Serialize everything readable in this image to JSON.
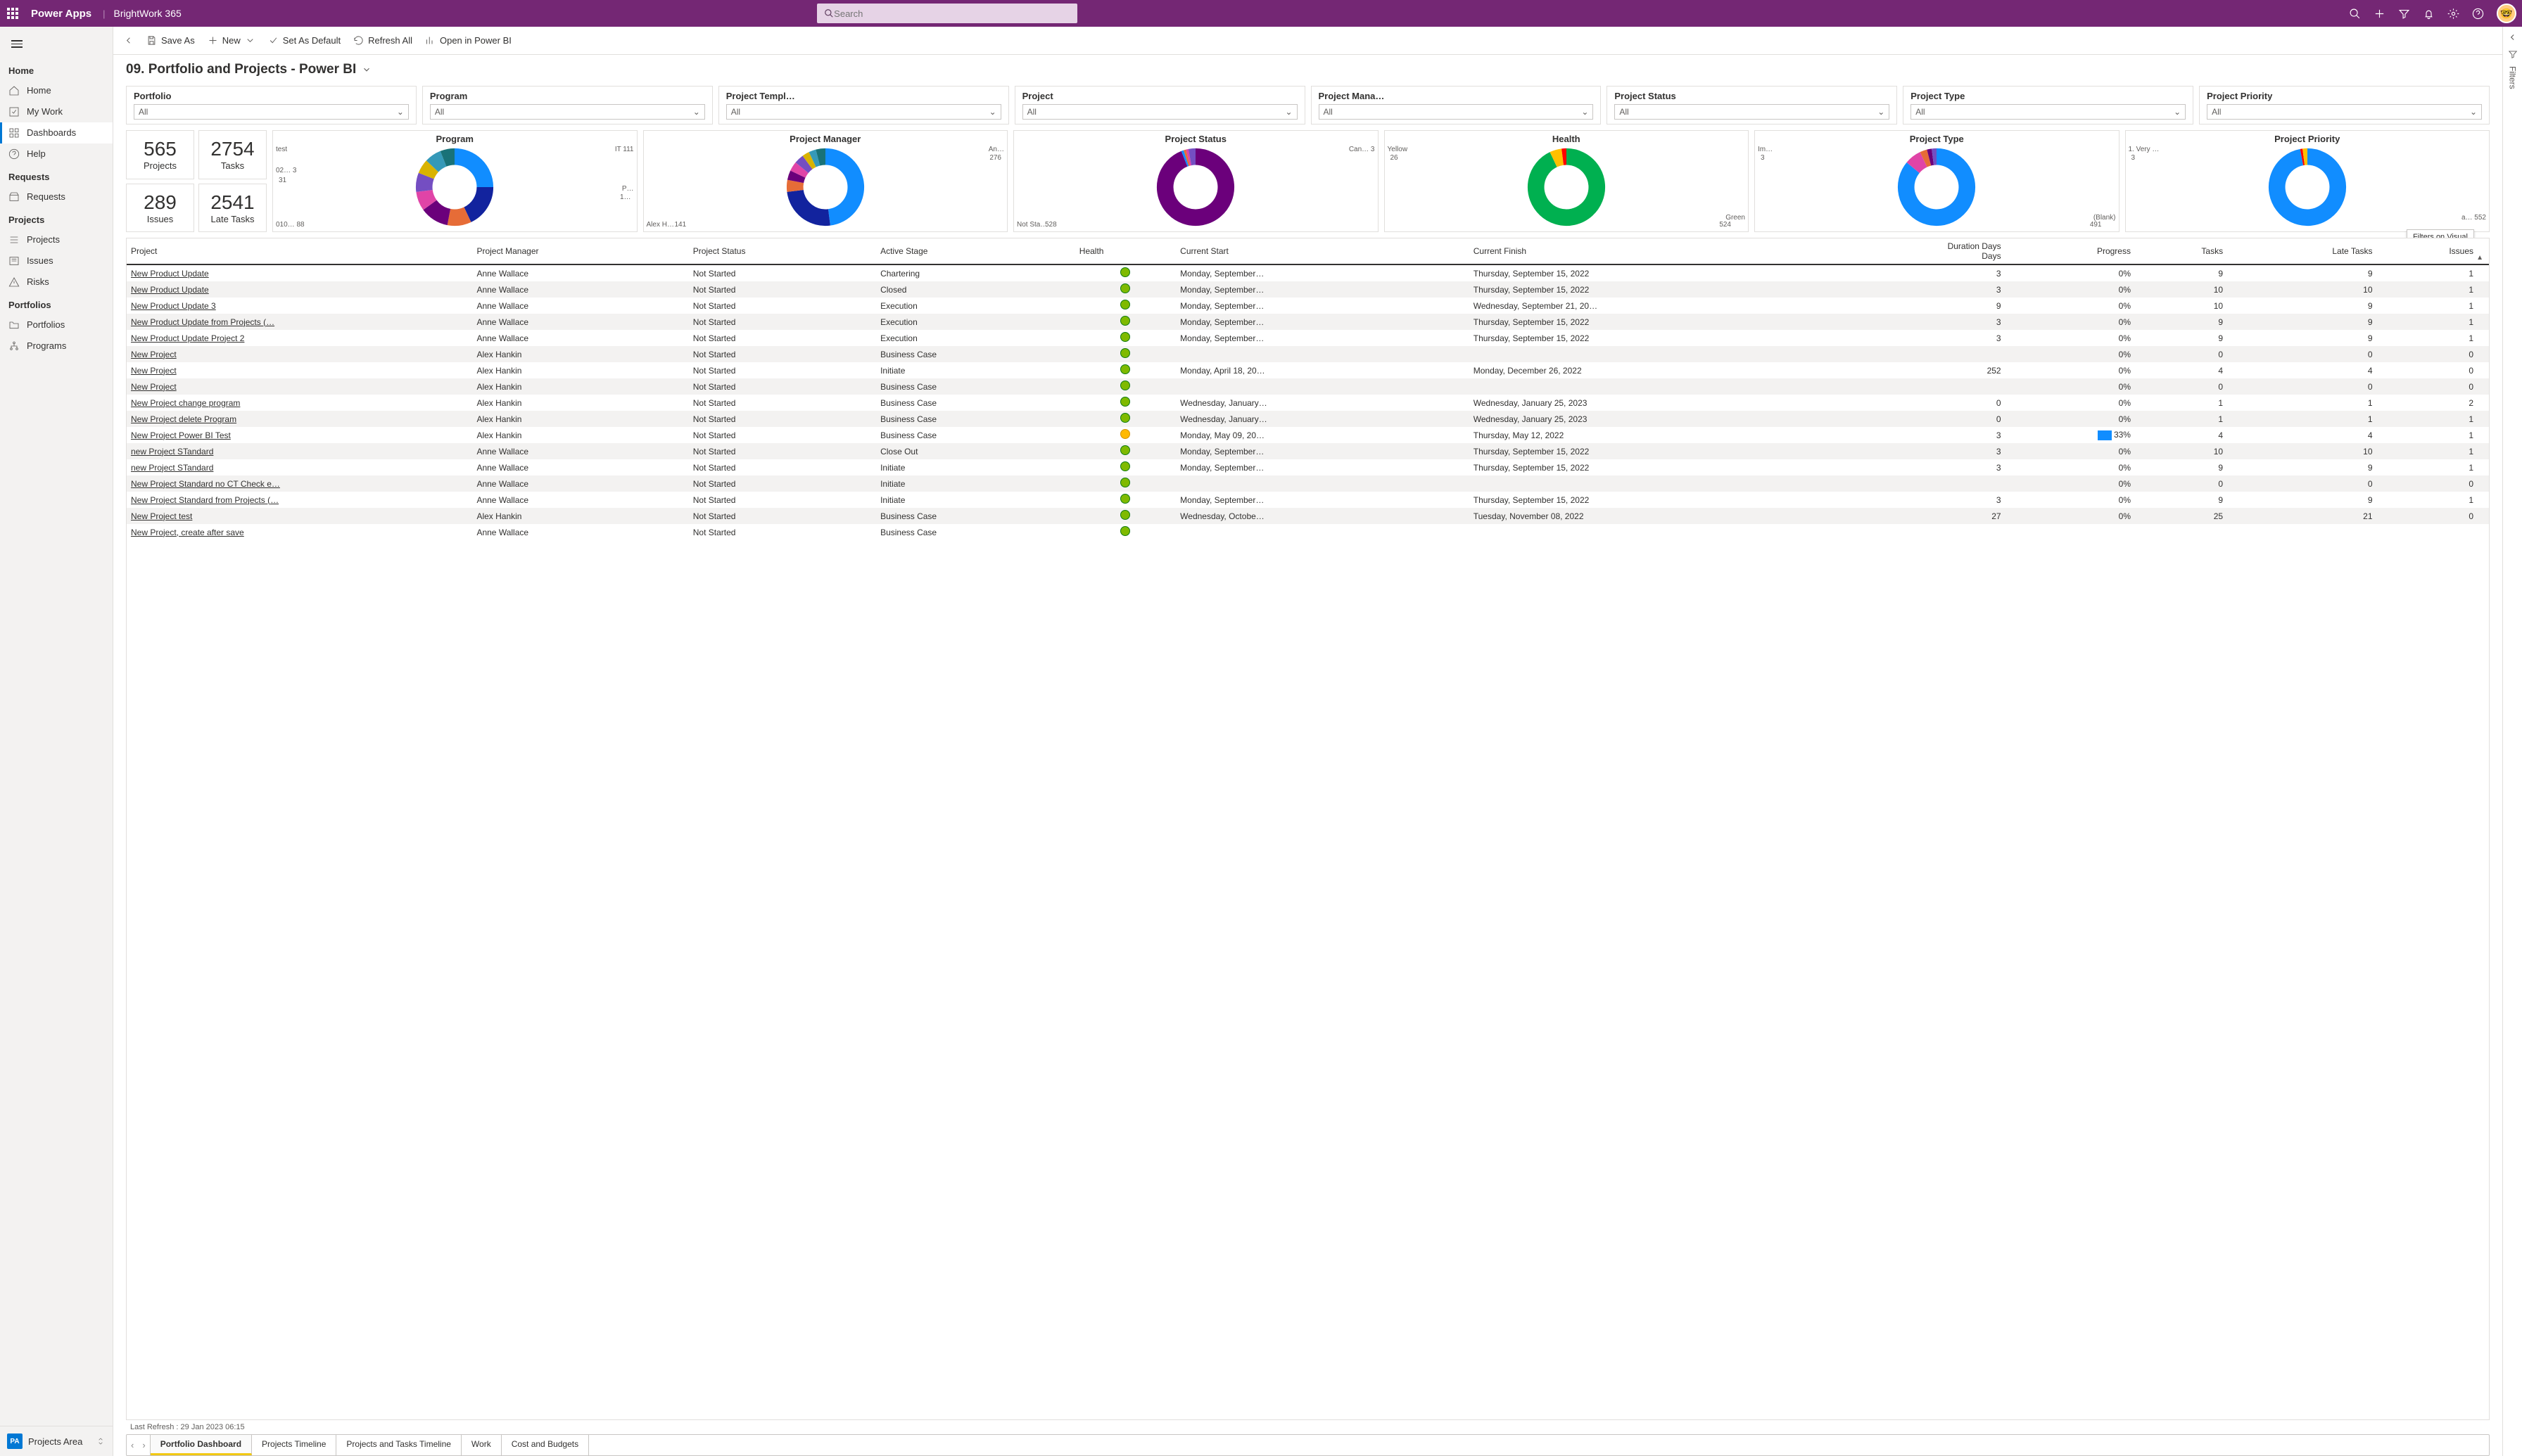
{
  "topbar": {
    "app": "Power Apps",
    "workspace": "BrightWork 365",
    "search_placeholder": "Search"
  },
  "sidebar": {
    "groups": [
      {
        "label": "Home",
        "items": [
          {
            "label": "Home",
            "icon": "home"
          },
          {
            "label": "My Work",
            "icon": "check"
          },
          {
            "label": "Dashboards",
            "icon": "dash",
            "selected": true
          },
          {
            "label": "Help",
            "icon": "help"
          }
        ]
      },
      {
        "label": "Requests",
        "items": [
          {
            "label": "Requests",
            "icon": "inbox"
          }
        ]
      },
      {
        "label": "Projects",
        "items": [
          {
            "label": "Projects",
            "icon": "list"
          },
          {
            "label": "Issues",
            "icon": "issue"
          },
          {
            "label": "Risks",
            "icon": "warn"
          }
        ]
      },
      {
        "label": "Portfolios",
        "items": [
          {
            "label": "Portfolios",
            "icon": "folder"
          },
          {
            "label": "Programs",
            "icon": "sitemap"
          }
        ]
      }
    ],
    "area": {
      "badge": "PA",
      "label": "Projects Area"
    }
  },
  "cmdbar": {
    "save_as": "Save As",
    "new": "New",
    "set_default": "Set As Default",
    "refresh": "Refresh All",
    "open_pbi": "Open in Power BI"
  },
  "title": "09. Portfolio and Projects - Power BI",
  "slicers": [
    {
      "label": "Portfolio",
      "value": "All"
    },
    {
      "label": "Program",
      "value": "All"
    },
    {
      "label": "Project Templ…",
      "value": "All"
    },
    {
      "label": "Project",
      "value": "All"
    },
    {
      "label": "Project Mana…",
      "value": "All"
    },
    {
      "label": "Project Status",
      "value": "All"
    },
    {
      "label": "Project Type",
      "value": "All"
    },
    {
      "label": "Project Priority",
      "value": "All"
    }
  ],
  "kpis": [
    {
      "value": "565",
      "label": "Projects"
    },
    {
      "value": "2754",
      "label": "Tasks"
    },
    {
      "value": "289",
      "label": "Issues"
    },
    {
      "value": "2541",
      "label": "Late Tasks"
    }
  ],
  "chart_data": [
    {
      "type": "pie",
      "title": "Program",
      "labels": [
        {
          "text": "test",
          "pos": "tl"
        },
        {
          "text": "IT 111",
          "pos": "tr"
        },
        {
          "text": "02…  3",
          "pos": "l1"
        },
        {
          "text": "31",
          "pos": "l2"
        },
        {
          "text": "P…",
          "pos": "r1"
        },
        {
          "text": "1…",
          "pos": "r2"
        },
        {
          "text": "010… 88",
          "pos": "bl"
        }
      ],
      "segments": [
        {
          "color": "#118dff",
          "v": 25
        },
        {
          "color": "#12239e",
          "v": 18
        },
        {
          "color": "#e66c37",
          "v": 10
        },
        {
          "color": "#6b007b",
          "v": 12
        },
        {
          "color": "#e044a7",
          "v": 8
        },
        {
          "color": "#744ec2",
          "v": 8
        },
        {
          "color": "#d9b300",
          "v": 6
        },
        {
          "color": "#3599b8",
          "v": 7
        },
        {
          "color": "#197278",
          "v": 6
        }
      ]
    },
    {
      "type": "pie",
      "title": "Project Manager",
      "labels": [
        {
          "text": "An…",
          "pos": "tr"
        },
        {
          "text": "276",
          "pos": "tr2"
        },
        {
          "text": "Alex H…",
          "pos": "bl"
        },
        {
          "text": "141",
          "pos": "bl2"
        }
      ],
      "segments": [
        {
          "color": "#118dff",
          "v": 48
        },
        {
          "color": "#12239e",
          "v": 25
        },
        {
          "color": "#e66c37",
          "v": 5
        },
        {
          "color": "#6b007b",
          "v": 4
        },
        {
          "color": "#e044a7",
          "v": 4
        },
        {
          "color": "#744ec2",
          "v": 4
        },
        {
          "color": "#d9b300",
          "v": 3
        },
        {
          "color": "#3599b8",
          "v": 3
        },
        {
          "color": "#197278",
          "v": 4
        }
      ]
    },
    {
      "type": "pie",
      "title": "Project Status",
      "labels": [
        {
          "text": "Can… 3",
          "pos": "tr"
        },
        {
          "text": "Not Sta…",
          "pos": "bl"
        },
        {
          "text": "528",
          "pos": "bl2"
        }
      ],
      "segments": [
        {
          "color": "#6b007b",
          "v": 94
        },
        {
          "color": "#118dff",
          "v": 1
        },
        {
          "color": "#e66c37",
          "v": 1
        },
        {
          "color": "#e044a7",
          "v": 1
        },
        {
          "color": "#744ec2",
          "v": 3
        }
      ]
    },
    {
      "type": "pie",
      "title": "Health",
      "labels": [
        {
          "text": "Yellow",
          "pos": "tl"
        },
        {
          "text": "26",
          "pos": "tl2"
        },
        {
          "text": "Green",
          "pos": "br"
        },
        {
          "text": "524",
          "pos": "br2"
        }
      ],
      "segments": [
        {
          "color": "#00b050",
          "v": 93
        },
        {
          "color": "#ffc000",
          "v": 5
        },
        {
          "color": "#ff0000",
          "v": 2
        }
      ]
    },
    {
      "type": "pie",
      "title": "Project Type",
      "labels": [
        {
          "text": "Im…",
          "pos": "tl"
        },
        {
          "text": "3",
          "pos": "tl2"
        },
        {
          "text": "(Blank)",
          "pos": "br"
        },
        {
          "text": "491",
          "pos": "br2"
        }
      ],
      "segments": [
        {
          "color": "#118dff",
          "v": 86
        },
        {
          "color": "#e044a7",
          "v": 7
        },
        {
          "color": "#e66c37",
          "v": 3
        },
        {
          "color": "#6b007b",
          "v": 2
        },
        {
          "color": "#744ec2",
          "v": 2
        }
      ]
    },
    {
      "type": "pie",
      "title": "Project Priority",
      "labels": [
        {
          "text": "1. Very …",
          "pos": "tl"
        },
        {
          "text": "3",
          "pos": "tl2"
        },
        {
          "text": "a… 552",
          "pos": "br"
        }
      ],
      "segments": [
        {
          "color": "#118dff",
          "v": 97
        },
        {
          "color": "#ff0000",
          "v": 1
        },
        {
          "color": "#ffc000",
          "v": 2
        }
      ]
    }
  ],
  "tooltip": "Filters on Visual",
  "table": {
    "columns": [
      "Project",
      "Project Manager",
      "Project Status",
      "Active Stage",
      "Health",
      "Current Start",
      "Current Finish",
      "Duration Days",
      "Progress",
      "Tasks",
      "Late Tasks",
      "Issues"
    ],
    "rows": [
      [
        "New Product Update",
        "Anne Wallace",
        "Not Started",
        "Chartering",
        "g",
        "Monday, September…",
        "Thursday, September 15, 2022",
        "3",
        "0%",
        "9",
        "9",
        "1"
      ],
      [
        "New Product Update",
        "Anne Wallace",
        "Not Started",
        "Closed",
        "g",
        "Monday, September…",
        "Thursday, September 15, 2022",
        "3",
        "0%",
        "10",
        "10",
        "1"
      ],
      [
        "New Product Update 3",
        "Anne Wallace",
        "Not Started",
        "Execution",
        "g",
        "Monday, September…",
        "Wednesday, September 21, 20…",
        "9",
        "0%",
        "10",
        "9",
        "1"
      ],
      [
        "New Product Update from Projects (…",
        "Anne Wallace",
        "Not Started",
        "Execution",
        "g",
        "Monday, September…",
        "Thursday, September 15, 2022",
        "3",
        "0%",
        "9",
        "9",
        "1"
      ],
      [
        "New Product Update Project 2",
        "Anne Wallace",
        "Not Started",
        "Execution",
        "g",
        "Monday, September…",
        "Thursday, September 15, 2022",
        "3",
        "0%",
        "9",
        "9",
        "1"
      ],
      [
        "New Project",
        "Alex Hankin",
        "Not Started",
        "Business Case",
        "g",
        "",
        "",
        "",
        "0%",
        "0",
        "0",
        "0"
      ],
      [
        "New Project",
        "Alex Hankin",
        "Not Started",
        "Initiate",
        "g",
        "Monday, April 18, 20…",
        "Monday, December 26, 2022",
        "252",
        "0%",
        "4",
        "4",
        "0"
      ],
      [
        "New Project",
        "Alex Hankin",
        "Not Started",
        "Business Case",
        "g",
        "",
        "",
        "",
        "0%",
        "0",
        "0",
        "0"
      ],
      [
        "New Project change program",
        "Alex Hankin",
        "Not Started",
        "Business Case",
        "g",
        "Wednesday, January…",
        "Wednesday, January 25, 2023",
        "0",
        "0%",
        "1",
        "1",
        "2"
      ],
      [
        "New Project delete Program",
        "Alex Hankin",
        "Not Started",
        "Business Case",
        "g",
        "Wednesday, January…",
        "Wednesday, January 25, 2023",
        "0",
        "0%",
        "1",
        "1",
        "1"
      ],
      [
        "New Project Power BI Test",
        "Alex Hankin",
        "Not Started",
        "Business Case",
        "y",
        "Monday, May 09, 20…",
        "Thursday, May 12, 2022",
        "3",
        "33%",
        "4",
        "4",
        "1"
      ],
      [
        "new Project STandard",
        "Anne Wallace",
        "Not Started",
        "Close Out",
        "g",
        "Monday, September…",
        "Thursday, September 15, 2022",
        "3",
        "0%",
        "10",
        "10",
        "1"
      ],
      [
        "new Project STandard",
        "Anne Wallace",
        "Not Started",
        "Initiate",
        "g",
        "Monday, September…",
        "Thursday, September 15, 2022",
        "3",
        "0%",
        "9",
        "9",
        "1"
      ],
      [
        "New Project Standard  no CT Check e…",
        "Anne Wallace",
        "Not Started",
        "Initiate",
        "g",
        "",
        "",
        "",
        "0%",
        "0",
        "0",
        "0"
      ],
      [
        "New Project Standard from Projects (…",
        "Anne Wallace",
        "Not Started",
        "Initiate",
        "g",
        "Monday, September…",
        "Thursday, September 15, 2022",
        "3",
        "0%",
        "9",
        "9",
        "1"
      ],
      [
        "New Project test",
        "Alex Hankin",
        "Not Started",
        "Business Case",
        "g",
        "Wednesday, Octobe…",
        "Tuesday, November 08, 2022",
        "27",
        "0%",
        "25",
        "21",
        "0"
      ],
      [
        "New Project, create after save",
        "Anne Wallace",
        "Not Started",
        "Business Case",
        "g",
        "",
        "",
        "",
        "",
        "",
        "",
        ""
      ]
    ]
  },
  "refresh": "Last Refresh :  29 Jan 2023 06:15",
  "tabs": [
    "Portfolio Dashboard",
    "Projects Timeline",
    "Projects and Tasks Timeline",
    "Work",
    "Cost and Budgets"
  ],
  "filters_label": "Filters"
}
